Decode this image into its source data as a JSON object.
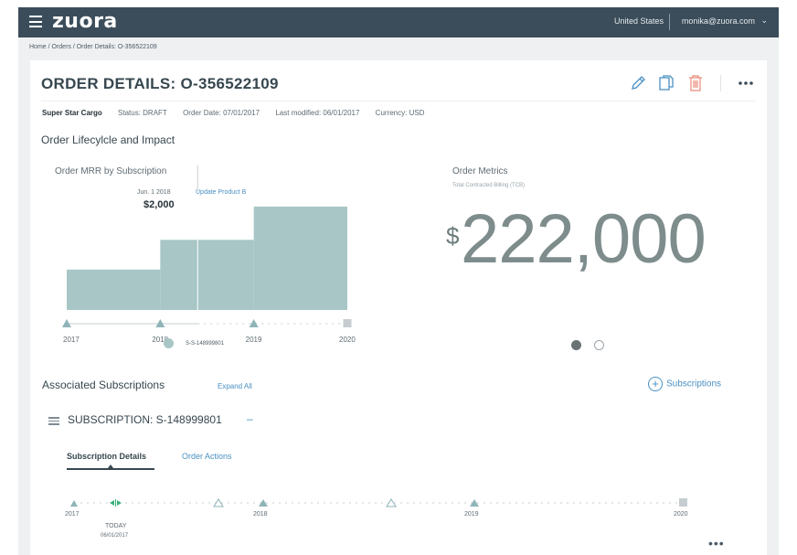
{
  "header": {
    "logo": "zuora",
    "region": "United States",
    "user": "monika@zuora.com"
  },
  "breadcrumb": "Home / Orders / Order Details: O-356522109",
  "order": {
    "title": "ORDER DETAILS: O-356522109",
    "company": "Super Star Cargo",
    "status": "Status: DRAFT",
    "order_date": "Order Date: 07/01/2017",
    "last_modified": "Last modified: 06/01/2017",
    "currency": "Currency: USD"
  },
  "lifecycle": {
    "section_title": "Order Lifecylcle and Impact",
    "mrr_chart": {
      "title": "Order MRR by Subscription",
      "annotation_date": "Jun. 1 2018",
      "annotation_amount": "$2,000",
      "annotation_action": "Update Product B",
      "legend_label": "S-S-148999801"
    },
    "metrics": {
      "title": "Order Metrics",
      "subtitle": "Total Contracted Billing (TCB)",
      "currency_symbol": "$",
      "value": "222,000"
    }
  },
  "chart_data": {
    "type": "area",
    "title": "Order MRR by Subscription",
    "x": [
      2017.0,
      2018.0,
      2019.0,
      2020.0
    ],
    "series": [
      {
        "name": "S-S-148999801",
        "steps": [
          {
            "x_start": 2017.0,
            "x_end": 2018.0,
            "value": 0.34
          },
          {
            "x_start": 2018.0,
            "x_end": 2019.0,
            "value": 0.59
          },
          {
            "x_start": 2019.0,
            "x_end": 2020.0,
            "value": 0.87
          }
        ]
      }
    ],
    "tick_labels": [
      "2017",
      "2018",
      "2019",
      "2020"
    ],
    "xlim": [
      2017,
      2020
    ],
    "ylim": [
      0,
      1
    ],
    "annotation": {
      "x": 2018.4,
      "label": "Jun. 1 2018",
      "value_label": "$2,000",
      "action": "Update Product B"
    },
    "markers": [
      {
        "x": 2017,
        "shape": "triangle"
      },
      {
        "x": 2018,
        "shape": "triangle"
      },
      {
        "x": 2019,
        "shape": "triangle"
      },
      {
        "x": 2020,
        "shape": "square"
      }
    ]
  },
  "associated": {
    "title": "Associated Subscriptions",
    "expand_all": "Expand All",
    "add_label": "Subscriptions",
    "subscription_title": "SUBSCRIPTION: S-148999801",
    "collapse_symbol": "–",
    "tabs": [
      "Subscription Details",
      "Order Actions"
    ],
    "today_label": "TODAY",
    "today_date": "06/01/2017",
    "timeline_labels": [
      "2017",
      "2018",
      "2019",
      "2020"
    ]
  },
  "colors": {
    "header_bg": "#3b4d5b",
    "chart_fill": "#a8c6c6",
    "link": "#4a90c2",
    "delete": "#e88a7a",
    "today": "#3ab07a"
  }
}
